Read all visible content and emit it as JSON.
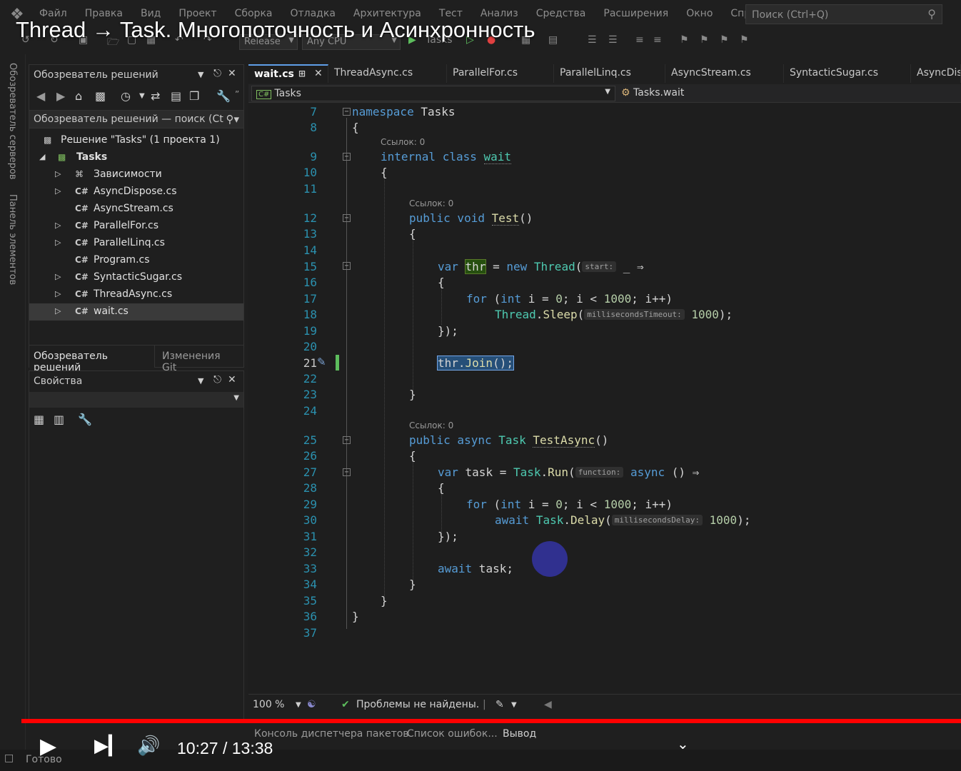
{
  "video": {
    "title": "Thread → Task. Многопоточность и Асинхронность",
    "time_current": "10:27",
    "time_separator": "/",
    "time_total": "13:38"
  },
  "menu": {
    "items": [
      "Файл",
      "Правка",
      "Вид",
      "Проект",
      "Сборка",
      "Отладка",
      "Архитектура",
      "Тест",
      "Анализ",
      "Средства",
      "Расширения",
      "Окно",
      "Справка"
    ],
    "search_placeholder": "Поиск (Ctrl+Q)"
  },
  "toolbar": {
    "config": "Release",
    "platform": "Any CPU",
    "start_target": "Tasks"
  },
  "vertical_tabs": [
    "Обозреватель серверов",
    "Панель элементов"
  ],
  "solution_explorer": {
    "title": "Обозреватель решений",
    "search_text": "Обозреватель решений — поиск (Ct",
    "solution_label": "Решение \"Tasks\"  (1 проекта 1)",
    "project": "Tasks",
    "items": [
      {
        "label": "Зависимости",
        "icon": "dependencies-icon",
        "expandable": true
      },
      {
        "label": "AsyncDispose.cs",
        "icon": "csharp-file-icon",
        "expandable": true
      },
      {
        "label": "AsyncStream.cs",
        "icon": "csharp-file-icon",
        "expandable": false
      },
      {
        "label": "ParallelFor.cs",
        "icon": "csharp-file-icon",
        "expandable": true
      },
      {
        "label": "ParallelLinq.cs",
        "icon": "csharp-file-icon",
        "expandable": true
      },
      {
        "label": "Program.cs",
        "icon": "csharp-file-icon",
        "expandable": false
      },
      {
        "label": "SyntacticSugar.cs",
        "icon": "csharp-file-icon",
        "expandable": true
      },
      {
        "label": "ThreadAsync.cs",
        "icon": "csharp-file-icon",
        "expandable": true
      },
      {
        "label": "wait.cs",
        "icon": "csharp-file-icon",
        "expandable": true,
        "selected": true
      }
    ],
    "csharp_glyph": "C#",
    "tab_solution": "Обозреватель решений",
    "tab_git": "Изменения Git"
  },
  "properties": {
    "title": "Свойства"
  },
  "editor_tabs": [
    {
      "label": "wait.cs",
      "active": true
    },
    {
      "label": "ThreadAsync.cs"
    },
    {
      "label": "ParallelFor.cs"
    },
    {
      "label": "ParallelLinq.cs"
    },
    {
      "label": "AsyncStream.cs"
    },
    {
      "label": "SyntacticSugar.cs"
    },
    {
      "label": "AsyncDisp"
    }
  ],
  "navbar": {
    "project": "Tasks",
    "class": "Tasks.wait"
  },
  "editor": {
    "line_numbers": [
      "7",
      "8",
      "9",
      "10",
      "11",
      "12",
      "13",
      "14",
      "15",
      "16",
      "17",
      "18",
      "19",
      "20",
      "21",
      "22",
      "23",
      "24",
      "25",
      "26",
      "27",
      "28",
      "29",
      "30",
      "31",
      "32",
      "33",
      "34",
      "35",
      "36",
      "37"
    ],
    "lens_refs": "Ссылок: 0",
    "hint_start": "start:",
    "hint_ms_timeout": "millisecondsTimeout:",
    "hint_function": "function:",
    "hint_ms_delay": "millisecondsDelay:"
  },
  "editor_status": {
    "zoom": "100 %",
    "problems": "Проблемы не найдены."
  },
  "bottom_tabs": [
    "Консоль диспетчера пакетов",
    "Список ошибок...",
    "Вывод"
  ],
  "status": {
    "ready": "Готово"
  },
  "colors": {
    "keyword": "#569cd6",
    "type": "#4ec9b0",
    "method": "#dcdcaa",
    "number": "#b5cea8",
    "line_number": "#2b91af",
    "progress": "#ff0000"
  }
}
